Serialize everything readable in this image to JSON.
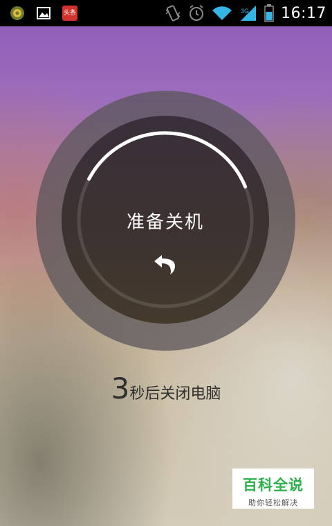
{
  "status_bar": {
    "left_icons": [
      "puzzle-icon",
      "image-icon",
      "news-app-icon"
    ],
    "news_app_label": "头条",
    "right_icons": [
      "vibrate-icon",
      "alarm-icon",
      "wifi-icon",
      "signal-icon",
      "battery-icon"
    ],
    "time": "16:17"
  },
  "dialog": {
    "title": "准备关机",
    "undo_icon": "undo-arrow-icon",
    "progress": 0.25
  },
  "countdown": {
    "number": "3",
    "text": "秒后关闭电脑"
  },
  "watermark": {
    "title": "百科全说",
    "subtitle": "助你轻松解决"
  },
  "colors": {
    "status_bar_bg": "#000000",
    "status_icon_blue": "#34b5e5",
    "arc_color": "#ffffff",
    "watermark_green": "#2bb04a"
  }
}
